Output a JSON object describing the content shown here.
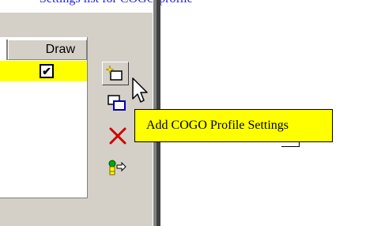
{
  "caption": "Settings list for COGO profile",
  "list": {
    "column_header": "Draw",
    "row_checked_symbol": "✔"
  },
  "toolbar": {
    "add_icon": "new-item-icon",
    "copy_icon": "copy-icon",
    "delete_icon": "delete-x-icon",
    "import_icon": "import-icon"
  },
  "tooltip": {
    "text": "Add COGO Profile Settings"
  },
  "colors": {
    "highlight": "#ffff00",
    "tooltip_bg": "#ffff00",
    "delete": "#cc0000",
    "caption": "#1f1fd6"
  }
}
